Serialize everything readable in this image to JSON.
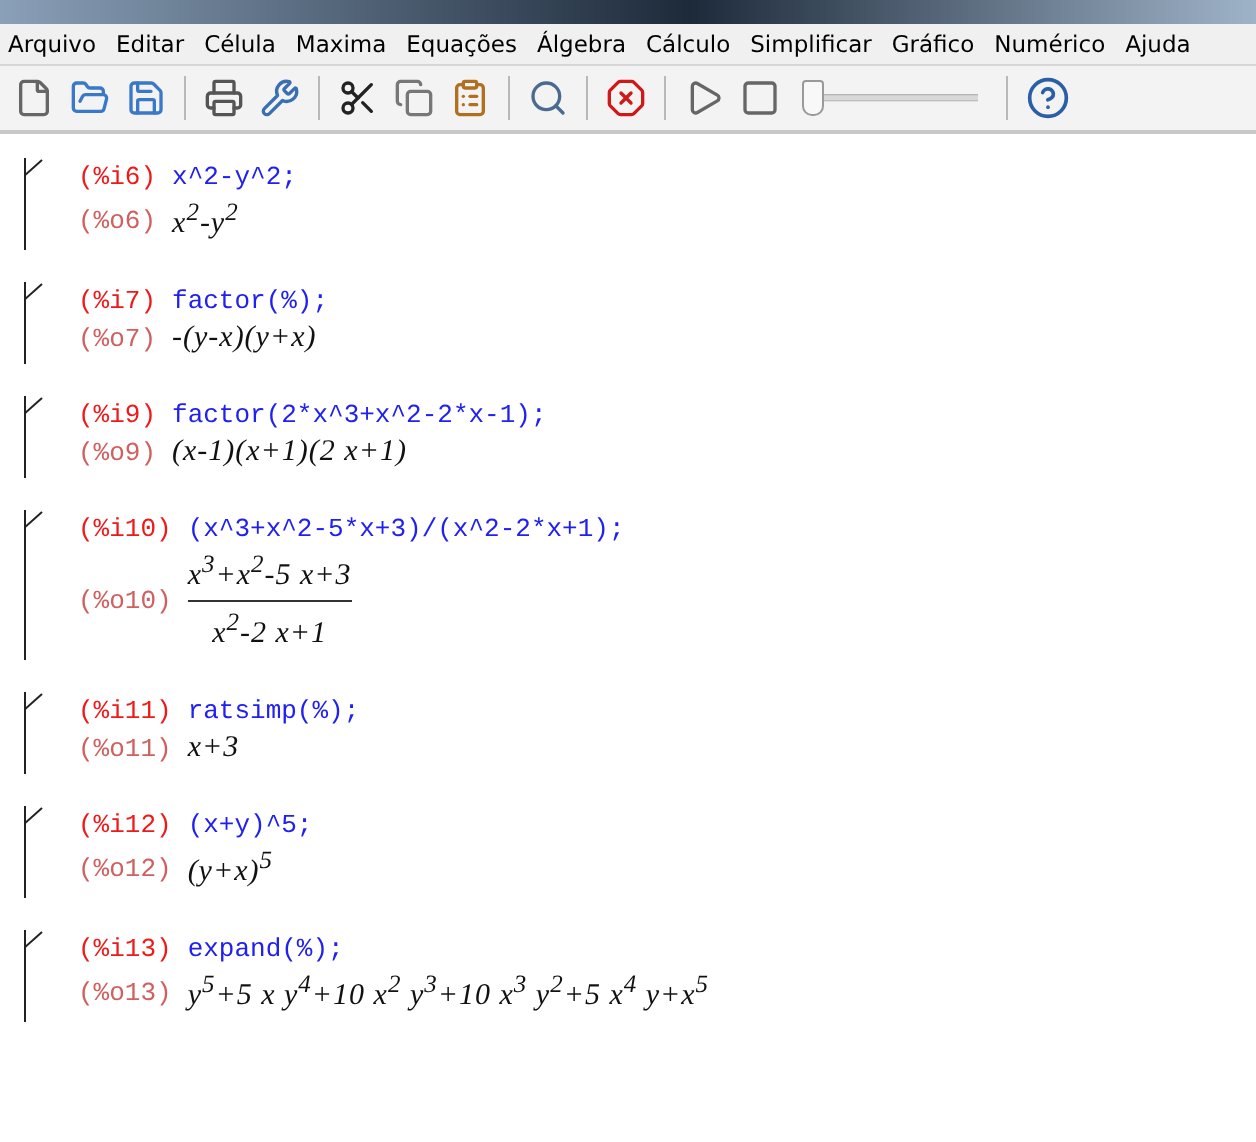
{
  "menu": [
    "Arquivo",
    "Editar",
    "Célula",
    "Maxima",
    "Equações",
    "Álgebra",
    "Cálculo",
    "Simplificar",
    "Gráfico",
    "Numérico",
    "Ajuda"
  ],
  "toolbar": {
    "slider": {
      "level": 0
    }
  },
  "cells": [
    {
      "input_label": "(%i6)",
      "input": "x^2-y^2;",
      "output_label": "(%o6)",
      "output": {
        "kind": "line",
        "text": "x$^{2}$-y$^{2}$"
      }
    },
    {
      "input_label": "(%i7)",
      "input": "factor(%);",
      "output_label": "(%o7)",
      "output": {
        "kind": "line",
        "text": "-(y-x)(y+x)"
      }
    },
    {
      "input_label": "(%i9)",
      "input": "factor(2*x^3+x^2-2*x-1);",
      "output_label": "(%o9)",
      "output": {
        "kind": "line",
        "text": "(x-1)(x+1)(2 x+1)"
      }
    },
    {
      "input_label": "(%i10)",
      "input": "(x^3+x^2-5*x+3)/(x^2-2*x+1);",
      "output_label": "(%o10)",
      "output": {
        "kind": "fraction",
        "numerator": "x$^{3}$+x$^{2}$-5 x+3",
        "denominator": "x$^{2}$-2 x+1"
      }
    },
    {
      "input_label": "(%i11)",
      "input": "ratsimp(%);",
      "output_label": "(%o11)",
      "output": {
        "kind": "line",
        "text": "x+3"
      }
    },
    {
      "input_label": "(%i12)",
      "input": "(x+y)^5;",
      "output_label": "(%o12)",
      "output": {
        "kind": "line",
        "text": "(y+x)$^{5}$"
      }
    },
    {
      "input_label": "(%i13)",
      "input": "expand(%);",
      "output_label": "(%o13)",
      "output": {
        "kind": "line",
        "text": "y$^{5}$+5 x y$^{4}$+10 x$^{2}$ y$^{3}$+10 x$^{3}$ y$^{2}$+5 x$^{4}$ y+x$^{5}$"
      }
    }
  ]
}
